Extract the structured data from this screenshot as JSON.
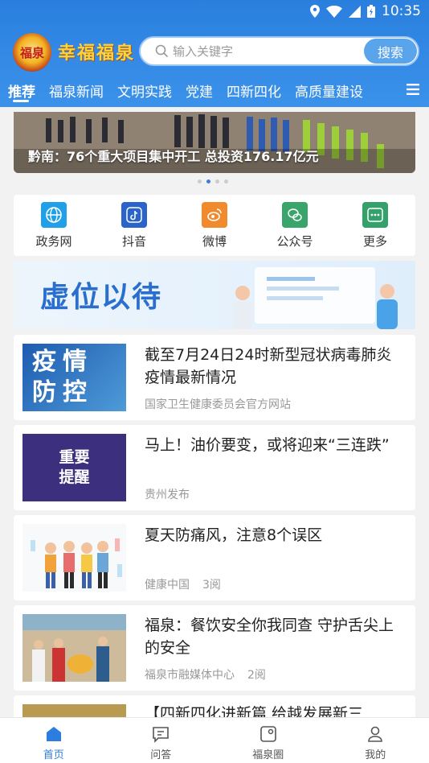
{
  "status": {
    "time": "10:35"
  },
  "header": {
    "logo_text": "福泉",
    "brand": "幸福福泉",
    "search": {
      "placeholder": "输入关键字",
      "button": "搜索"
    }
  },
  "tabs": [
    {
      "label": "推荐",
      "active": true
    },
    {
      "label": "福泉新闻"
    },
    {
      "label": "文明实践"
    },
    {
      "label": "党建"
    },
    {
      "label": "四新四化"
    },
    {
      "label": "高质量建设"
    }
  ],
  "banner": {
    "title": "黔南：76个重大项目集中开工 总投资176.17亿元",
    "dots": 4,
    "active_dot": 1
  },
  "quick_links": [
    {
      "label": "政务网",
      "icon": "globe-icon",
      "color": "#1fa0e8"
    },
    {
      "label": "抖音",
      "icon": "douyin-icon",
      "color": "#2a63c9"
    },
    {
      "label": "微博",
      "icon": "weibo-icon",
      "color": "#f08a2c"
    },
    {
      "label": "公众号",
      "icon": "wechat-icon",
      "color": "#3aa56a"
    },
    {
      "label": "更多",
      "icon": "more-icon",
      "color": "#34a06a"
    }
  ],
  "ad": {
    "text": "虚位以待"
  },
  "feed": [
    {
      "title": "截至7月24日24时新型冠状病毒肺炎疫情最新情况",
      "source": "国家卫生健康委员会官方网站",
      "reads": "",
      "thumb_text": "疫情防控"
    },
    {
      "title": "马上！油价要变，或将迎来“三连跌”",
      "source": "贵州发布",
      "reads": "",
      "thumb_text": "重要提醒"
    },
    {
      "title": "夏天防痛风，注意8个误区",
      "source": "健康中国",
      "reads": "3阅",
      "thumb_text": ""
    },
    {
      "title": "福泉：餐饮安全你我同查 守护舌尖上的安全",
      "source": "福泉市融媒体中心",
      "reads": "2阅",
      "thumb_text": ""
    },
    {
      "title": "【四新四化进新篇 给越发展新三",
      "source": "",
      "reads": "",
      "thumb_text": ""
    }
  ],
  "bottom_nav": [
    {
      "label": "首页",
      "active": true
    },
    {
      "label": "问答"
    },
    {
      "label": "福泉圈"
    },
    {
      "label": "我的"
    }
  ]
}
